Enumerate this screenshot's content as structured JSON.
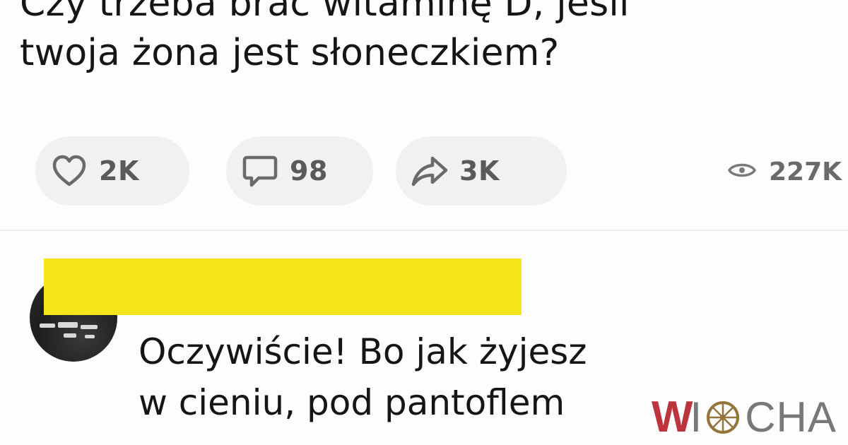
{
  "post": {
    "text_lines": [
      "Czy trzeba brać witaminę D, jeśli",
      "twoja żona jest słoneczkiem?"
    ]
  },
  "actions": {
    "like": {
      "icon": "heart-icon",
      "count": "2K"
    },
    "comment": {
      "icon": "speech-bubble-icon",
      "count": "98"
    },
    "share": {
      "icon": "share-arrow-icon",
      "count": "3K"
    },
    "views": {
      "icon": "eye-icon",
      "count": "227K"
    }
  },
  "comment": {
    "author_name_redacted": true,
    "redaction_color": "#f7e51c",
    "text_lines": [
      "Oczywiście! Bo jak żyjesz",
      "w cieniu, pod pantoflem"
    ]
  },
  "watermark": {
    "brand": "WIOCHA",
    "first_letter": "W",
    "rest_before_wheel": "I",
    "rest_after_wheel": "CHA",
    "accent_color": "#b8232d",
    "text_color": "#6d6d6d"
  },
  "colors": {
    "pill_background": "#f1f1f3",
    "icon_gray": "#6a6a6a"
  }
}
